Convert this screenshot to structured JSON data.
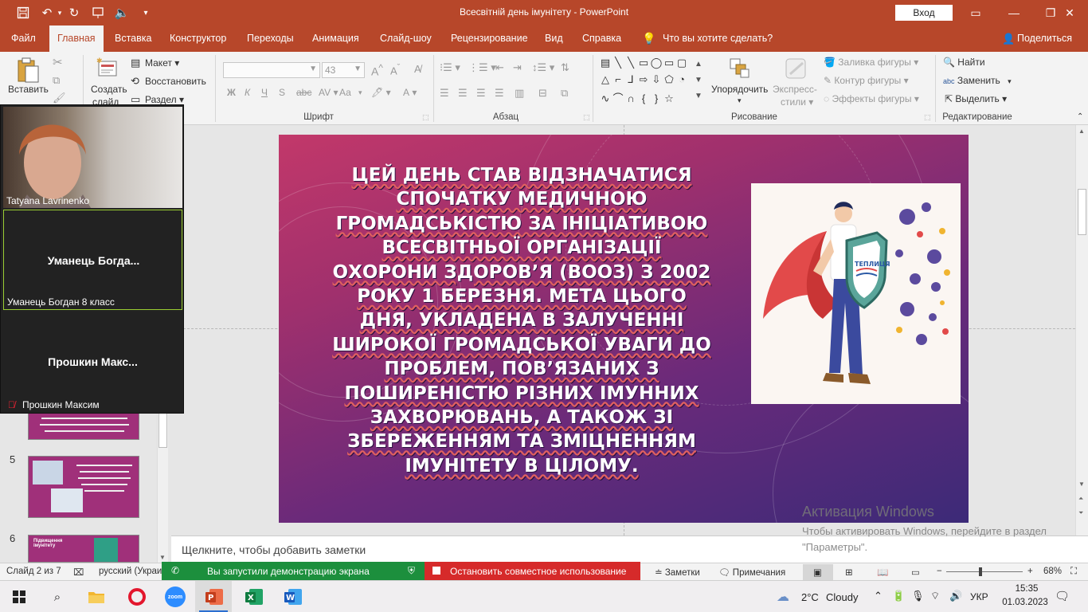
{
  "window": {
    "title": "Всесвітній день імунітету  -  PowerPoint",
    "signin_label": "Вход"
  },
  "tabs": [
    {
      "label": "Файл"
    },
    {
      "label": "Главная",
      "active": true
    },
    {
      "label": "Вставка"
    },
    {
      "label": "Конструктор"
    },
    {
      "label": "Переходы"
    },
    {
      "label": "Анимация"
    },
    {
      "label": "Слайд-шоу"
    },
    {
      "label": "Рецензирование"
    },
    {
      "label": "Вид"
    },
    {
      "label": "Справка"
    }
  ],
  "tell_me": "Что вы хотите сделать?",
  "share_label": "Поделиться",
  "ribbon": {
    "paste_label": "Вставить",
    "new_slide_label_1": "Создать",
    "new_slide_label_2": "слайд",
    "layout_label": "Макет",
    "reset_label": "Восстановить",
    "section_label": "Раздел",
    "font_size_value": "43",
    "group_font": "Шрифт",
    "group_paragraph": "Абзац",
    "group_drawing": "Рисование",
    "group_editing": "Редактирование",
    "arrange_label": "Упорядочить",
    "express_styles_1": "Экспресс-",
    "express_styles_2": "стили",
    "fill_label": "Заливка фигуры",
    "outline_label": "Контур фигуры",
    "effects_label": "Эффекты фигуры",
    "find_label": "Найти",
    "replace_label": "Заменить",
    "select_label": "Выделить",
    "bold": "Ж",
    "italic": "К",
    "underline": "Ч",
    "strike": "S",
    "aa": "Аа",
    "font_a": "А"
  },
  "thumbnails": [
    {
      "number": "5"
    },
    {
      "number": "6",
      "title": "Підвищення імунітету"
    }
  ],
  "slide": {
    "text_lines": [
      "ЦЕЙ ДЕНЬ СТАВ ВІДЗНАЧАТИСЯ",
      "СПОЧАТКУ МЕДИЧНОЮ",
      "ГРОМАДСЬКІСТЮ ЗА ІНІЦІАТИВОЮ",
      "ВСЕСВІТНЬОЇ ОРГАНІЗАЦІЇ",
      "ОХОРОНИ ЗДОРОВ’Я (ВООЗ) З 2002",
      "РОКУ 1 БЕРЕЗНЯ. МЕТА ЦЬОГО",
      "ДНЯ, УКЛАДЕНА В ЗАЛУЧЕННІ",
      "ШИРОКОЇ ГРОМАДСЬКОЇ УВАГИ ДО",
      "ПРОБЛЕМ, ПОВ’ЯЗАНИХ З",
      "ПОШИРЕНІСТЮ РІЗНИХ ІМУННИХ",
      "ЗАХВОРЮВАНЬ, А ТАКОЖ ЗІ",
      "ЗБЕРЕЖЕННЯМ ТА ЗМІЦНЕННЯМ",
      "ІМУНІТЕТУ В ЦІЛОМУ."
    ],
    "shield_text": "ТЕПЛИЦЯ"
  },
  "notes_placeholder": "Щелкните, чтобы добавить заметки",
  "watermark": {
    "line1": "Активация Windows",
    "line2": "Чтобы активировать Windows, перейдите в раздел \"Параметры\"."
  },
  "status": {
    "slide_counter": "Слайд 2 из 7",
    "language": "русский (Украи",
    "sharing_text": "Вы запустили демонстрацию экрана",
    "stop_sharing": "Остановить совместное использование",
    "notes_btn": "Заметки",
    "comments_btn": "Примечания",
    "zoom_level": "68%",
    "zoom_fraction": 0.45
  },
  "zoom_meeting": {
    "participants": [
      {
        "name": "Tatyana Lavrinenko",
        "video": true
      },
      {
        "name": "Уманець Богдан 8 класс",
        "display": "Уманець  Богда...",
        "active": true
      },
      {
        "name": "Прошкин Максим",
        "display": "Прошкин  Макс...",
        "muted": true
      }
    ]
  },
  "taskbar": {
    "weather_temp": "2°C",
    "weather_desc": "Cloudy",
    "lang": "УКР",
    "time": "15:35",
    "date": "01.03.2023"
  },
  "colors": {
    "powerpoint_accent": "#b7472a",
    "share_green": "#1c8f3d",
    "stop_red": "#d62a2a"
  }
}
